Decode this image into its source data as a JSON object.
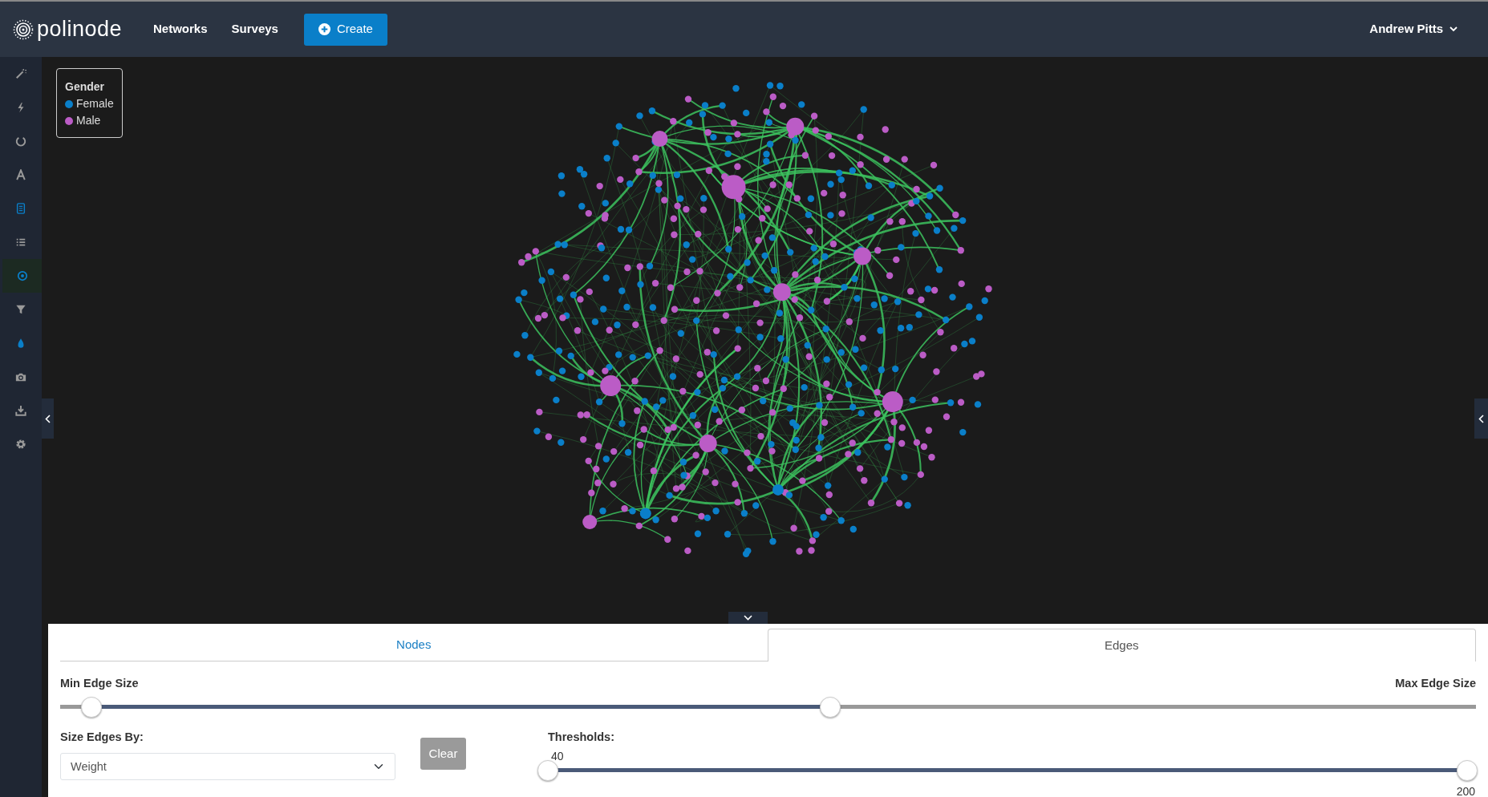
{
  "navbar": {
    "logo": "polinode",
    "links": [
      {
        "label": "Networks"
      },
      {
        "label": "Surveys"
      }
    ],
    "create_button": "Create",
    "user": "Andrew Pitts"
  },
  "sidebar": {
    "items": [
      {
        "selected": false,
        "active": false
      },
      {
        "selected": false,
        "active": false
      },
      {
        "selected": false,
        "active": false
      },
      {
        "selected": false,
        "active": false
      },
      {
        "selected": false,
        "active": true
      },
      {
        "selected": false,
        "active": false
      },
      {
        "selected": true,
        "active": true
      },
      {
        "selected": false,
        "active": false
      },
      {
        "selected": false,
        "active": true
      },
      {
        "selected": false,
        "active": false
      },
      {
        "selected": false,
        "active": false
      },
      {
        "selected": false,
        "active": false
      }
    ]
  },
  "legend": {
    "title": "Gender",
    "items": [
      {
        "label": "Female",
        "color": "#0a7fc9"
      },
      {
        "label": "Male",
        "color": "#bb5cc6"
      }
    ]
  },
  "panel": {
    "tabs": [
      {
        "label": "Nodes",
        "selected": false
      },
      {
        "label": "Edges",
        "selected": true
      }
    ],
    "edge_size": {
      "min_label": "Min Edge Size",
      "max_label": "Max Edge Size",
      "thumbs": [
        {
          "level": 0.022
        },
        {
          "level": 0.544
        }
      ]
    },
    "size_by": {
      "label": "Size Edges By:",
      "value": "Weight"
    },
    "clear_button": "Clear",
    "thresholds": {
      "label": "Thresholds:",
      "thumbs": [
        {
          "level": 0,
          "reading": "40"
        },
        {
          "level": 1,
          "reading": "200"
        }
      ]
    }
  }
}
